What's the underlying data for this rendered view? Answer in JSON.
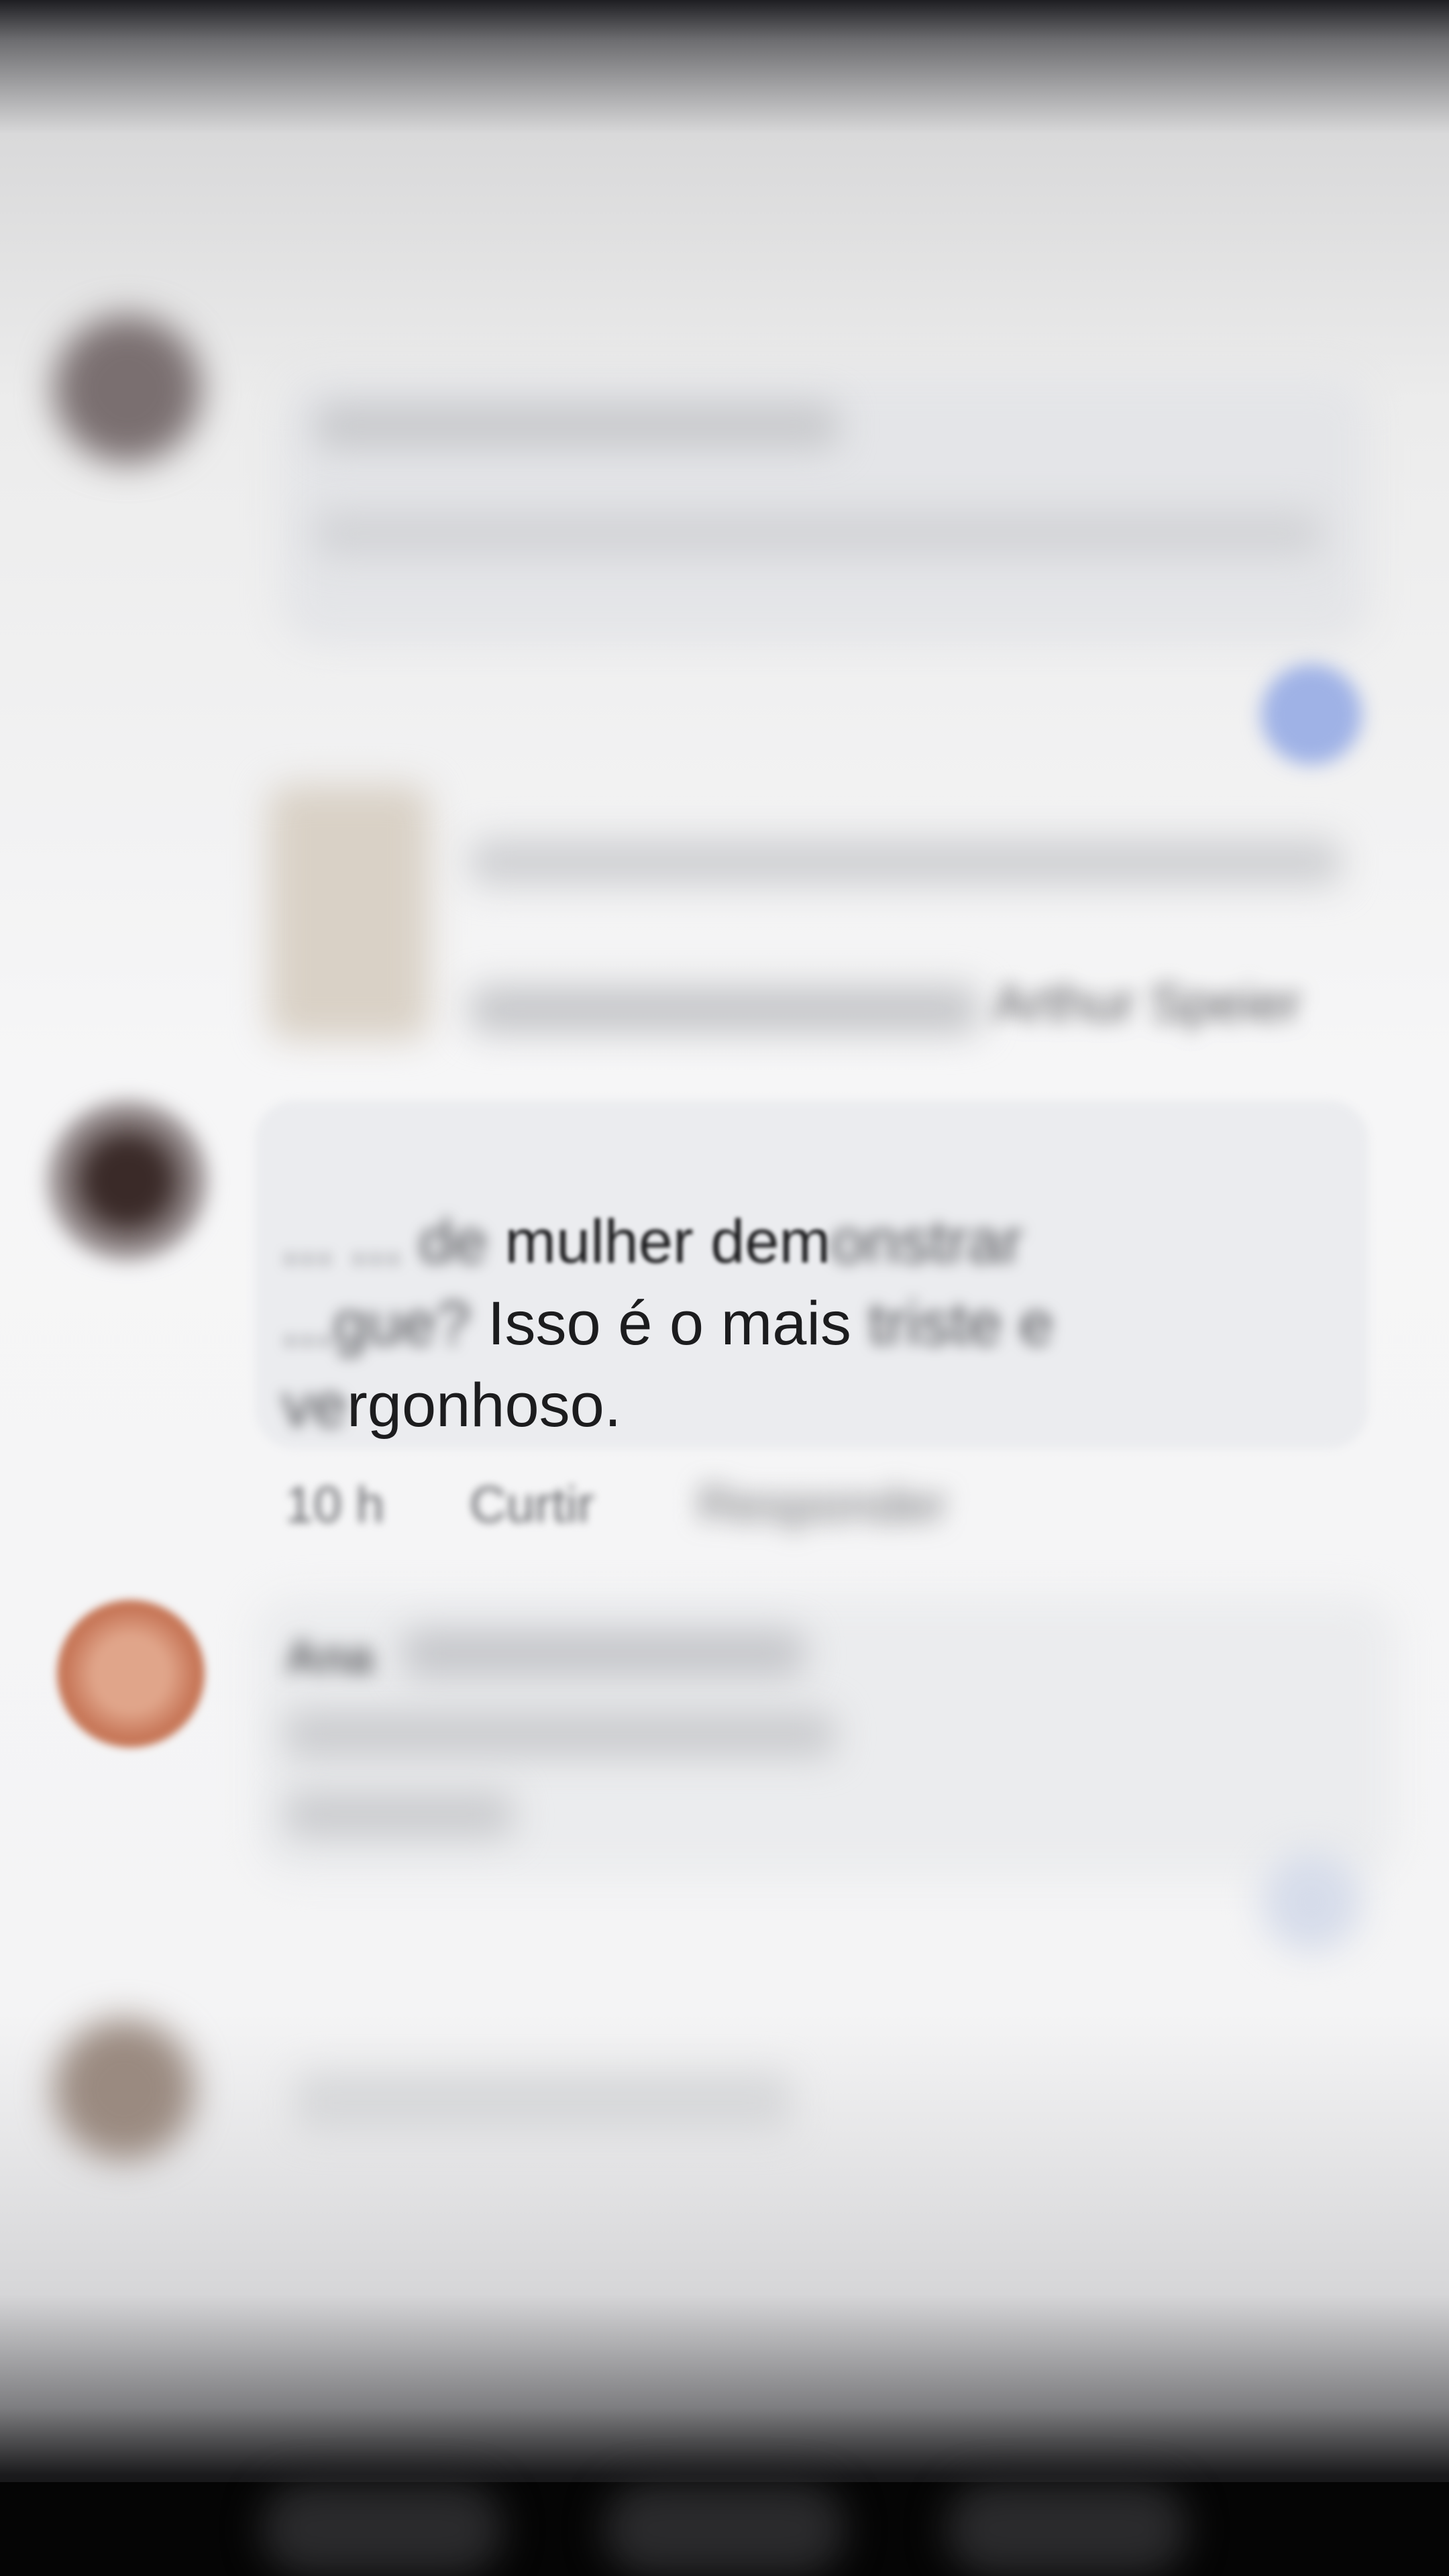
{
  "comment": {
    "author": "",
    "text_blur_lead": "... ... de",
    "text_clear_1": "mulher dem",
    "text_blur_1": "onstrar",
    "text_blur_2": "...gue?",
    "text_clear_2": "Isso é o mais",
    "text_blur_3": "triste e",
    "text_blur_4": "ve",
    "text_clear_3": "rgonhoso.",
    "time": "10 h",
    "like_label": "Curtir",
    "reply_label": "Responder"
  },
  "preview": {
    "line_2": "Arthur Speier"
  },
  "next_comment": {
    "author": "Ana"
  }
}
